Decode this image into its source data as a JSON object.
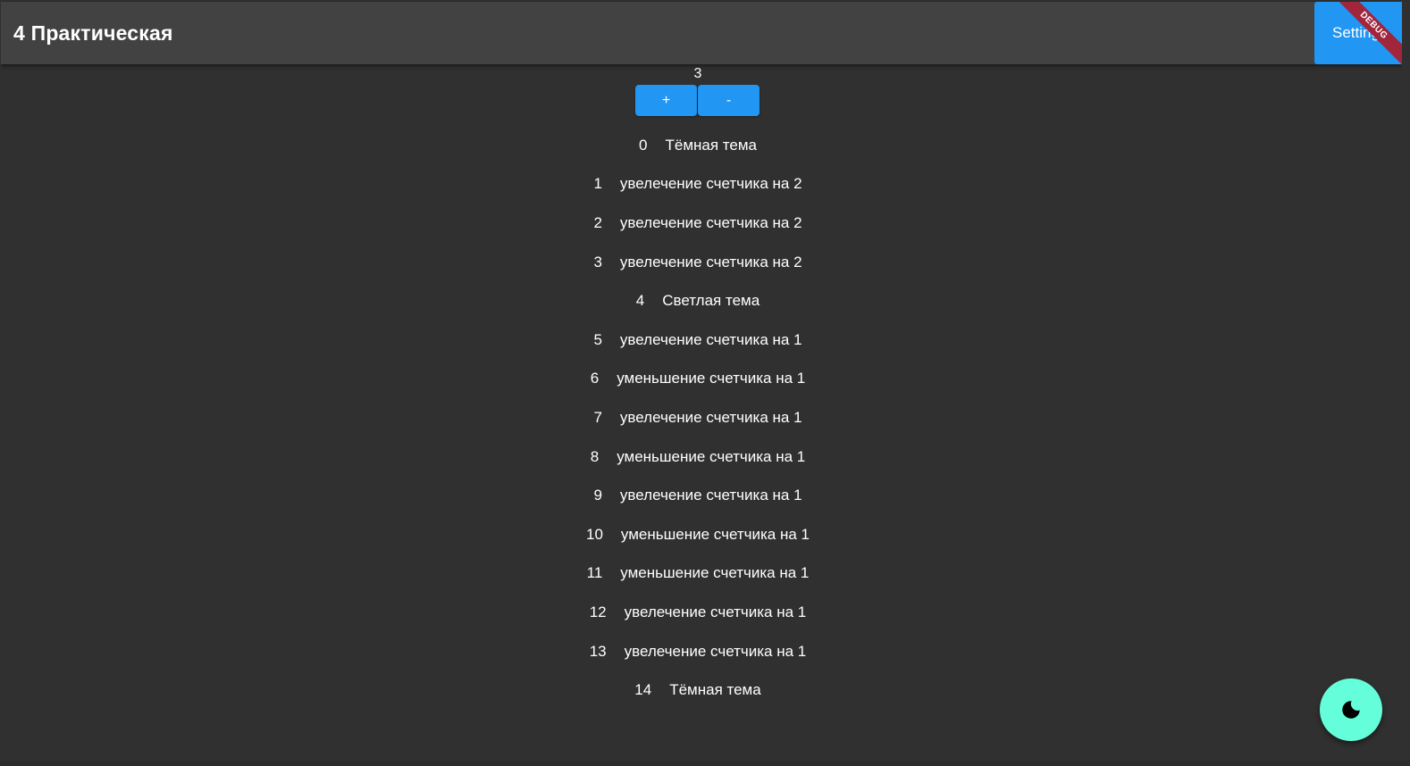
{
  "appbar": {
    "title": "4 Практическая",
    "settings_label": "Settings",
    "debug_label": "DEBUG"
  },
  "counter": {
    "value": "3",
    "plus_label": "+",
    "minus_label": "-"
  },
  "history": [
    {
      "index": "0",
      "text": "Тёмная тема"
    },
    {
      "index": "1",
      "text": "увелечение счетчика на 2"
    },
    {
      "index": "2",
      "text": "увелечение счетчика на 2"
    },
    {
      "index": "3",
      "text": "увелечение счетчика на 2"
    },
    {
      "index": "4",
      "text": "Светлая тема"
    },
    {
      "index": "5",
      "text": "увелечение счетчика на 1"
    },
    {
      "index": "6",
      "text": "уменьшение счетчика на 1"
    },
    {
      "index": "7",
      "text": "увелечение счетчика на 1"
    },
    {
      "index": "8",
      "text": "уменьшение счетчика на 1"
    },
    {
      "index": "9",
      "text": "увелечение счетчика на 1"
    },
    {
      "index": "10",
      "text": "уменьшение счетчика на 1"
    },
    {
      "index": "11",
      "text": "уменьшение счетчика на 1"
    },
    {
      "index": "12",
      "text": "увелечение счетчика на 1"
    },
    {
      "index": "13",
      "text": "увелечение счетчика на 1"
    },
    {
      "index": "14",
      "text": "Тёмная тема"
    }
  ],
  "fab": {
    "icon": "moon-icon"
  },
  "colors": {
    "background": "#303030",
    "appbar": "#424242",
    "primary": "#2196f3",
    "accent": "#64ffda",
    "debug": "#a1253b"
  }
}
